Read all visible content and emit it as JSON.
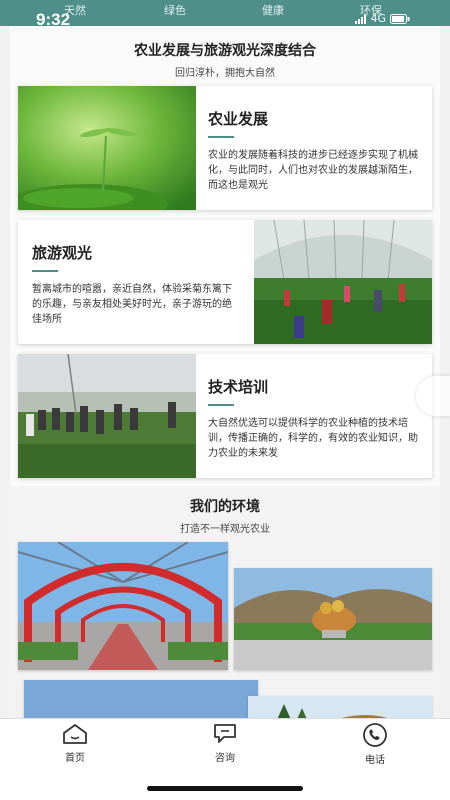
{
  "status_bar": {
    "time": "9:32",
    "network": "4G"
  },
  "top_tabs": [
    "天然",
    "绿色",
    "健康",
    "环保"
  ],
  "header": {
    "title": "农业发展与旅游观光深度结合",
    "subtitle": "回归淳朴，拥抱大自然"
  },
  "cards": [
    {
      "title": "农业发展",
      "desc": "农业的发展随着科技的进步已经逐步实现了机械化，与此同时，人们也对农业的发展越渐陌生，而这也是观光"
    },
    {
      "title": "旅游观光",
      "desc": "暂离城市的喧嚣，亲近自然，体验采菊东篱下的乐趣，与亲友相处美好时光，亲子游玩的绝佳场所"
    },
    {
      "title": "技术培训",
      "desc": "大自然优选可以提供科学的农业种植的技术培训，传播正确的，科学的，有效的农业知识，助力农业的未来发"
    }
  ],
  "environment": {
    "title": "我们的环境",
    "subtitle": "打造不一样观光农业"
  },
  "tabbar": [
    {
      "label": "首页",
      "icon": "home-icon"
    },
    {
      "label": "咨询",
      "icon": "chat-icon"
    },
    {
      "label": "电话",
      "icon": "phone-icon"
    }
  ],
  "colors": {
    "accent": "#4e8f8a"
  }
}
